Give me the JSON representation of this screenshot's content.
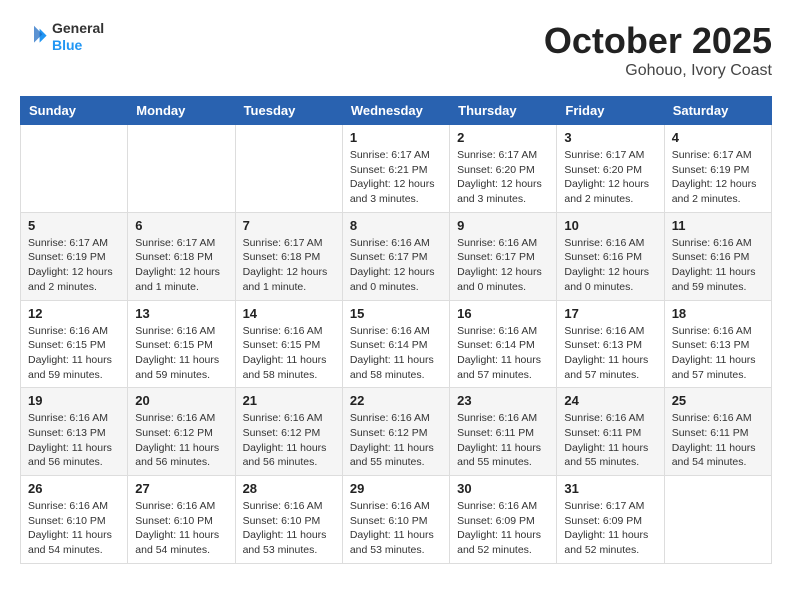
{
  "header": {
    "logo_line1": "General",
    "logo_line2": "Blue",
    "title": "October 2025",
    "subtitle": "Gohouo, Ivory Coast"
  },
  "weekdays": [
    "Sunday",
    "Monday",
    "Tuesday",
    "Wednesday",
    "Thursday",
    "Friday",
    "Saturday"
  ],
  "weeks": [
    [
      {
        "day": "",
        "info": ""
      },
      {
        "day": "",
        "info": ""
      },
      {
        "day": "",
        "info": ""
      },
      {
        "day": "1",
        "info": "Sunrise: 6:17 AM\nSunset: 6:21 PM\nDaylight: 12 hours\nand 3 minutes."
      },
      {
        "day": "2",
        "info": "Sunrise: 6:17 AM\nSunset: 6:20 PM\nDaylight: 12 hours\nand 3 minutes."
      },
      {
        "day": "3",
        "info": "Sunrise: 6:17 AM\nSunset: 6:20 PM\nDaylight: 12 hours\nand 2 minutes."
      },
      {
        "day": "4",
        "info": "Sunrise: 6:17 AM\nSunset: 6:19 PM\nDaylight: 12 hours\nand 2 minutes."
      }
    ],
    [
      {
        "day": "5",
        "info": "Sunrise: 6:17 AM\nSunset: 6:19 PM\nDaylight: 12 hours\nand 2 minutes."
      },
      {
        "day": "6",
        "info": "Sunrise: 6:17 AM\nSunset: 6:18 PM\nDaylight: 12 hours\nand 1 minute."
      },
      {
        "day": "7",
        "info": "Sunrise: 6:17 AM\nSunset: 6:18 PM\nDaylight: 12 hours\nand 1 minute."
      },
      {
        "day": "8",
        "info": "Sunrise: 6:16 AM\nSunset: 6:17 PM\nDaylight: 12 hours\nand 0 minutes."
      },
      {
        "day": "9",
        "info": "Sunrise: 6:16 AM\nSunset: 6:17 PM\nDaylight: 12 hours\nand 0 minutes."
      },
      {
        "day": "10",
        "info": "Sunrise: 6:16 AM\nSunset: 6:16 PM\nDaylight: 12 hours\nand 0 minutes."
      },
      {
        "day": "11",
        "info": "Sunrise: 6:16 AM\nSunset: 6:16 PM\nDaylight: 11 hours\nand 59 minutes."
      }
    ],
    [
      {
        "day": "12",
        "info": "Sunrise: 6:16 AM\nSunset: 6:15 PM\nDaylight: 11 hours\nand 59 minutes."
      },
      {
        "day": "13",
        "info": "Sunrise: 6:16 AM\nSunset: 6:15 PM\nDaylight: 11 hours\nand 59 minutes."
      },
      {
        "day": "14",
        "info": "Sunrise: 6:16 AM\nSunset: 6:15 PM\nDaylight: 11 hours\nand 58 minutes."
      },
      {
        "day": "15",
        "info": "Sunrise: 6:16 AM\nSunset: 6:14 PM\nDaylight: 11 hours\nand 58 minutes."
      },
      {
        "day": "16",
        "info": "Sunrise: 6:16 AM\nSunset: 6:14 PM\nDaylight: 11 hours\nand 57 minutes."
      },
      {
        "day": "17",
        "info": "Sunrise: 6:16 AM\nSunset: 6:13 PM\nDaylight: 11 hours\nand 57 minutes."
      },
      {
        "day": "18",
        "info": "Sunrise: 6:16 AM\nSunset: 6:13 PM\nDaylight: 11 hours\nand 57 minutes."
      }
    ],
    [
      {
        "day": "19",
        "info": "Sunrise: 6:16 AM\nSunset: 6:13 PM\nDaylight: 11 hours\nand 56 minutes."
      },
      {
        "day": "20",
        "info": "Sunrise: 6:16 AM\nSunset: 6:12 PM\nDaylight: 11 hours\nand 56 minutes."
      },
      {
        "day": "21",
        "info": "Sunrise: 6:16 AM\nSunset: 6:12 PM\nDaylight: 11 hours\nand 56 minutes."
      },
      {
        "day": "22",
        "info": "Sunrise: 6:16 AM\nSunset: 6:12 PM\nDaylight: 11 hours\nand 55 minutes."
      },
      {
        "day": "23",
        "info": "Sunrise: 6:16 AM\nSunset: 6:11 PM\nDaylight: 11 hours\nand 55 minutes."
      },
      {
        "day": "24",
        "info": "Sunrise: 6:16 AM\nSunset: 6:11 PM\nDaylight: 11 hours\nand 55 minutes."
      },
      {
        "day": "25",
        "info": "Sunrise: 6:16 AM\nSunset: 6:11 PM\nDaylight: 11 hours\nand 54 minutes."
      }
    ],
    [
      {
        "day": "26",
        "info": "Sunrise: 6:16 AM\nSunset: 6:10 PM\nDaylight: 11 hours\nand 54 minutes."
      },
      {
        "day": "27",
        "info": "Sunrise: 6:16 AM\nSunset: 6:10 PM\nDaylight: 11 hours\nand 54 minutes."
      },
      {
        "day": "28",
        "info": "Sunrise: 6:16 AM\nSunset: 6:10 PM\nDaylight: 11 hours\nand 53 minutes."
      },
      {
        "day": "29",
        "info": "Sunrise: 6:16 AM\nSunset: 6:10 PM\nDaylight: 11 hours\nand 53 minutes."
      },
      {
        "day": "30",
        "info": "Sunrise: 6:16 AM\nSunset: 6:09 PM\nDaylight: 11 hours\nand 52 minutes."
      },
      {
        "day": "31",
        "info": "Sunrise: 6:17 AM\nSunset: 6:09 PM\nDaylight: 11 hours\nand 52 minutes."
      },
      {
        "day": "",
        "info": ""
      }
    ]
  ]
}
